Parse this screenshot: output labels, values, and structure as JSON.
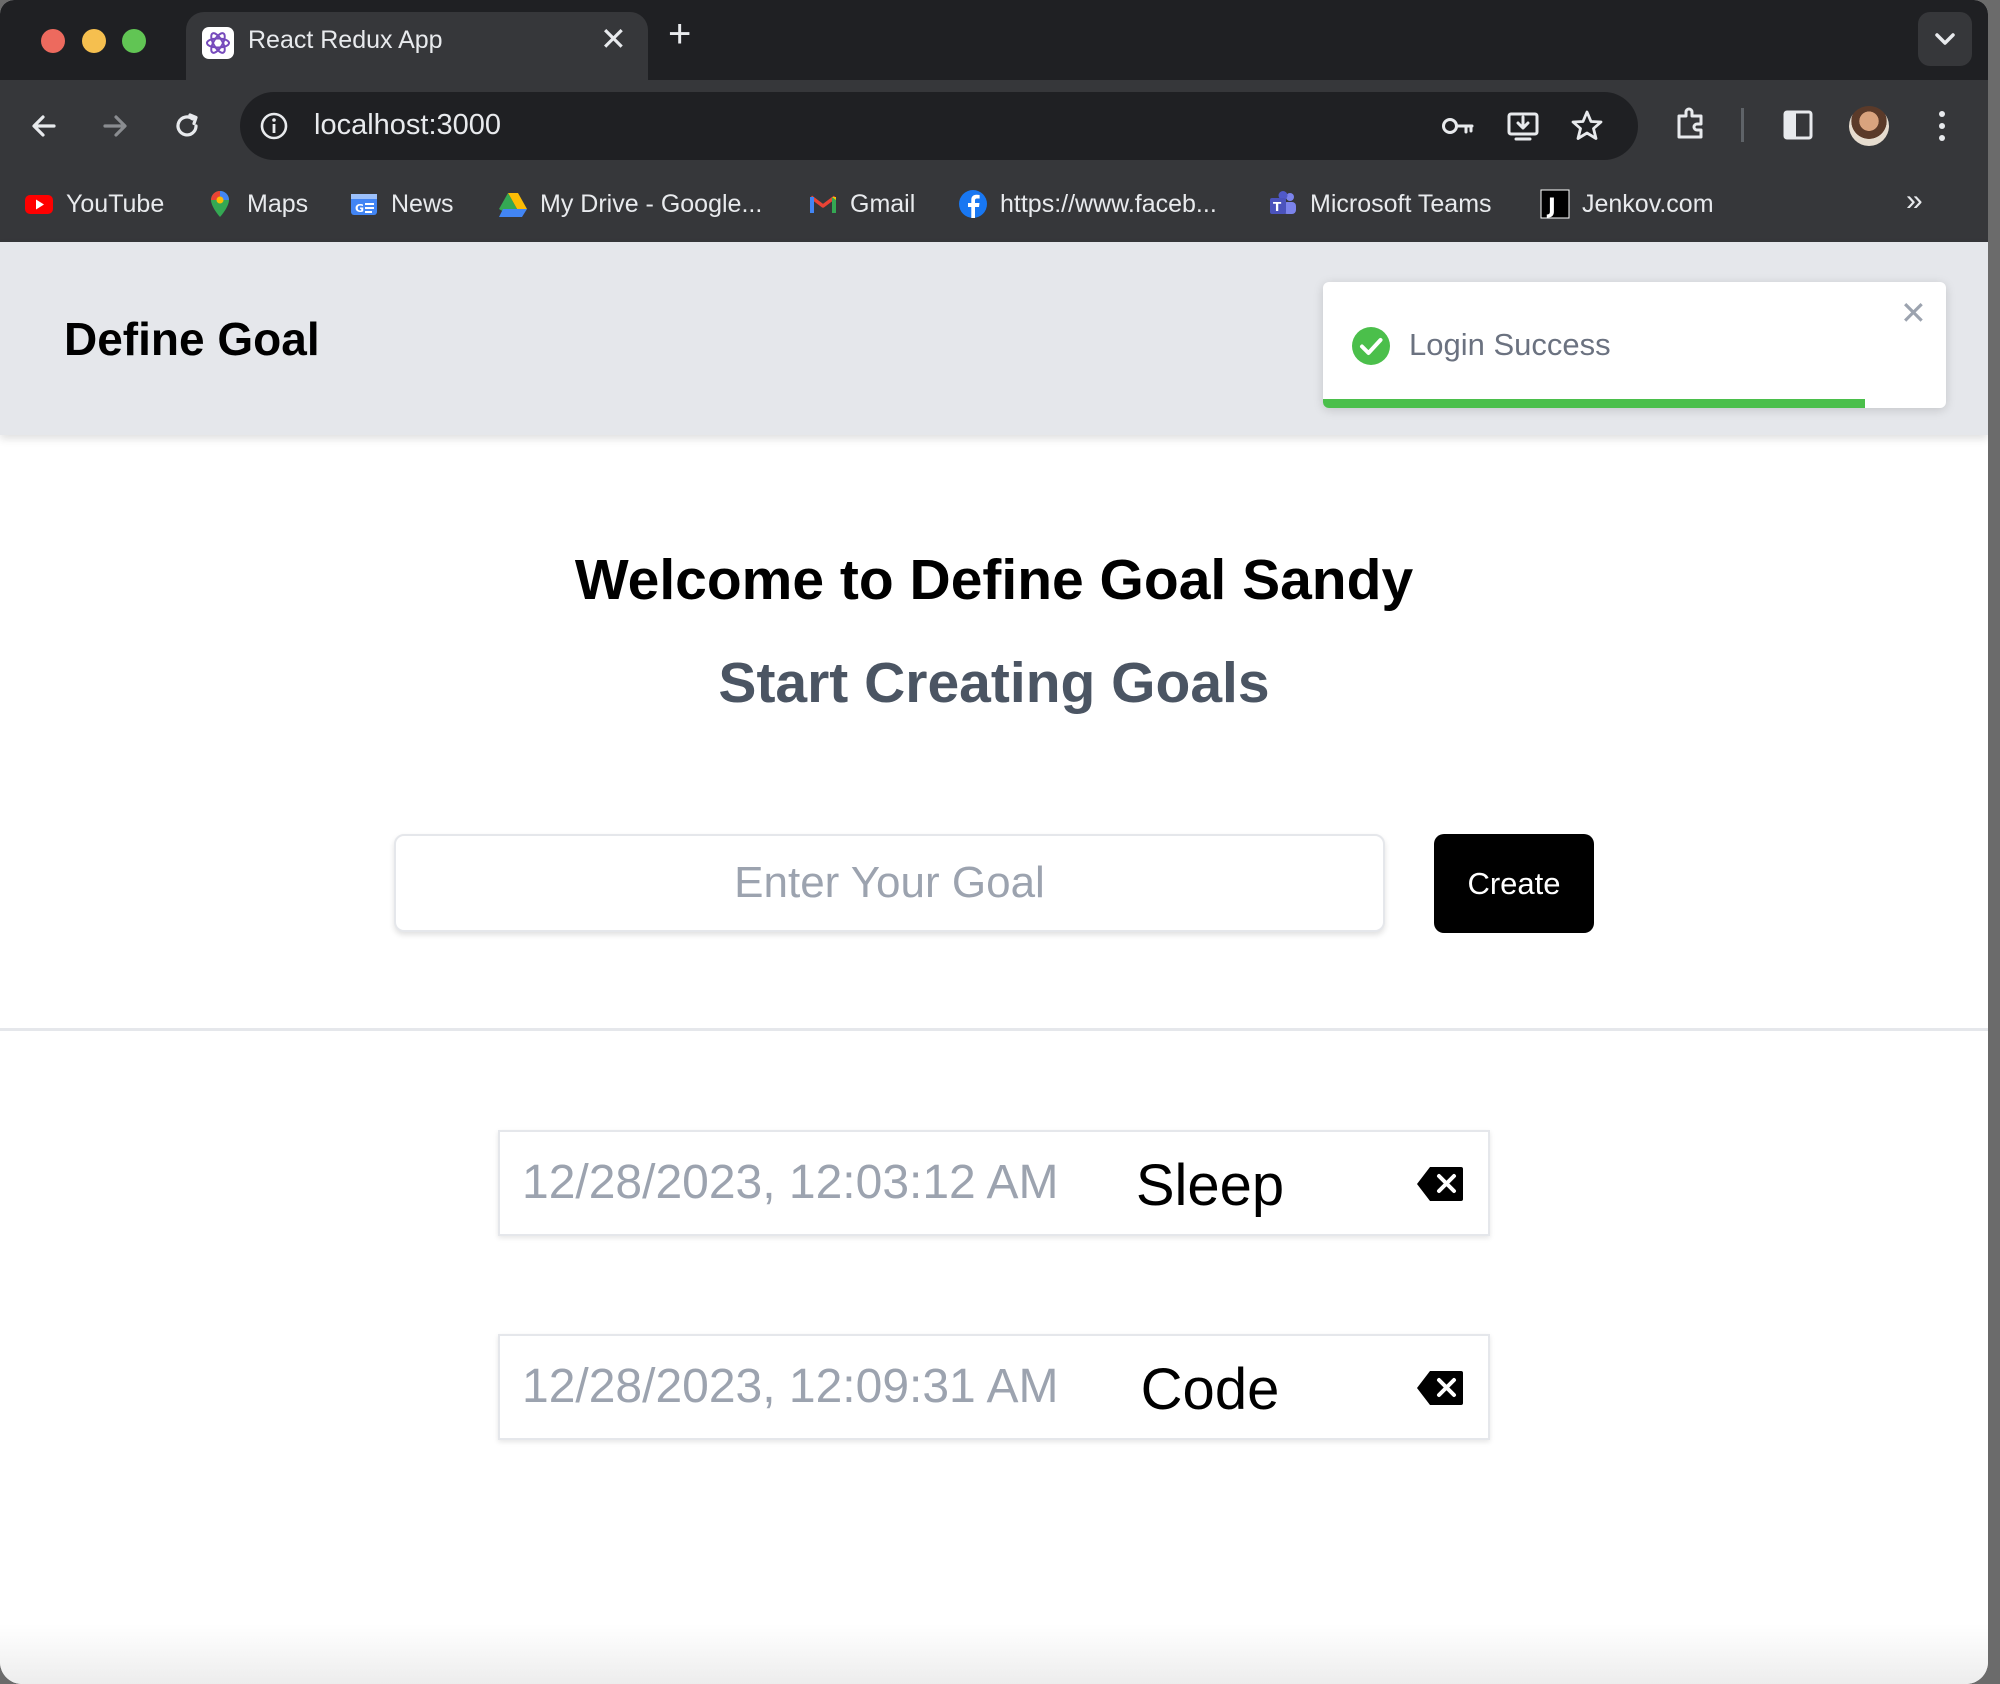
{
  "browser": {
    "tab_title": "React Redux App",
    "tab_close": "✕",
    "new_tab": "+",
    "url": "localhost:3000",
    "bookmarks": [
      {
        "label": "YouTube",
        "icon": "youtube-icon"
      },
      {
        "label": "Maps",
        "icon": "maps-icon"
      },
      {
        "label": "News",
        "icon": "news-icon"
      },
      {
        "label": "My Drive - Google...",
        "icon": "drive-icon"
      },
      {
        "label": "Gmail",
        "icon": "gmail-icon"
      },
      {
        "label": "https://www.faceb...",
        "icon": "facebook-icon"
      },
      {
        "label": "Microsoft Teams",
        "icon": "teams-icon"
      },
      {
        "label": "Jenkov.com",
        "icon": "jenkov-icon"
      }
    ],
    "bookmarks_more": "»"
  },
  "header": {
    "brand": "Define Goal"
  },
  "toast": {
    "message": "Login Success",
    "close": "✕",
    "progress": 0.87,
    "color": "#4bbf4b"
  },
  "main": {
    "welcome": "Welcome to Define Goal Sandy",
    "subtitle": "Start Creating Goals",
    "input_placeholder": "Enter Your Goal",
    "create_label": "Create"
  },
  "goals": [
    {
      "date": "12/28/2023, 12:03:12 AM",
      "text": "Sleep"
    },
    {
      "date": "12/28/2023, 12:09:31 AM",
      "text": "Code"
    }
  ]
}
